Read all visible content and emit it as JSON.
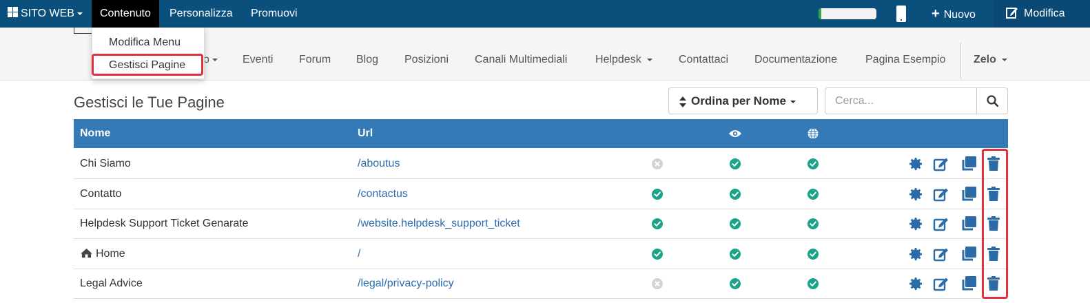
{
  "topbar": {
    "site_label": "SITO WEB",
    "content_label": "Contenuto",
    "customize_label": "Personalizza",
    "promote_label": "Promuovi",
    "progress_fraction": 0.05,
    "new_label": "Nuovo",
    "edit_label": "Modifica"
  },
  "dropdown": {
    "items": [
      "Modifica Menu",
      "Gestisci Pagine"
    ]
  },
  "nav": {
    "items": [
      "Eventi",
      "Forum",
      "Blog",
      "Posizioni",
      "Canali Multimediali",
      "Helpdesk",
      "Contattaci",
      "Documentazione",
      "Pagina Esempio"
    ],
    "hidden_item_fragment": "o",
    "user_label": "Zelo"
  },
  "page": {
    "title": "Gestisci le Tue Pagine",
    "sort_label": "Ordina per Nome",
    "search_placeholder": "Cerca..."
  },
  "table": {
    "headers": {
      "name": "Nome",
      "url": "Url",
      "visible_icon": "eye-icon",
      "published_icon": "globe-icon"
    },
    "rows": [
      {
        "name": "Chi Siamo",
        "url": "/aboutus",
        "home": false,
        "status1": false,
        "status2": true,
        "status3": true
      },
      {
        "name": "Contatto",
        "url": "/contactus",
        "home": false,
        "status1": true,
        "status2": true,
        "status3": true
      },
      {
        "name": "Helpdesk Support Ticket Genarate",
        "url": "/website.helpdesk_support_ticket",
        "home": false,
        "status1": true,
        "status2": true,
        "status3": true
      },
      {
        "name": "Home",
        "url": "/",
        "home": true,
        "status1": true,
        "status2": true,
        "status3": true
      },
      {
        "name": "Legal Advice",
        "url": "/legal/privacy-policy",
        "home": false,
        "status1": false,
        "status2": true,
        "status3": true
      }
    ]
  },
  "colors": {
    "topbar": "#0b4f7c",
    "header": "#337ab7",
    "check": "#1aa38a",
    "action": "#2b6ca8",
    "highlight": "#e0323d"
  }
}
